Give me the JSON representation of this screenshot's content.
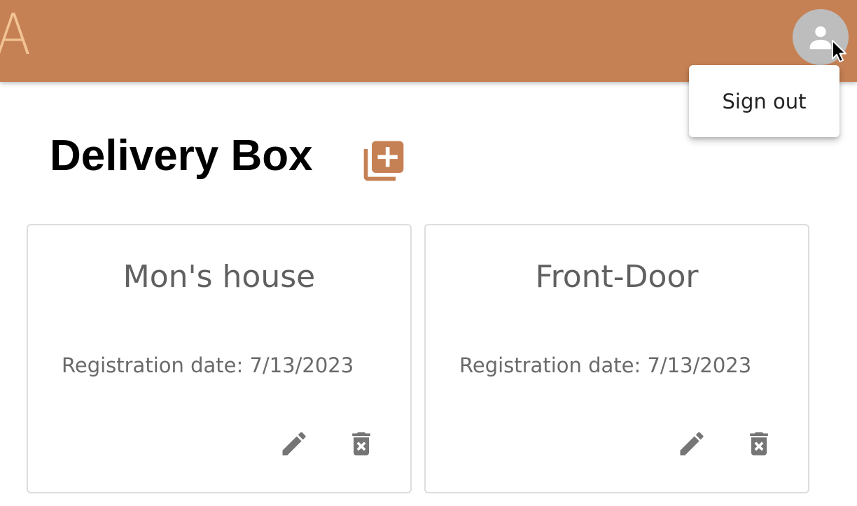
{
  "app": {
    "logo_letter": "A",
    "brand_color": "#c58154",
    "logo_color": "#f2c394"
  },
  "header": {
    "avatar_icon": "person-icon",
    "avatar_bg": "#bdbdbd"
  },
  "account_menu": {
    "items": [
      {
        "label": "Sign out"
      }
    ]
  },
  "page": {
    "title": "Delivery Box",
    "add_icon": "add-box-icon",
    "accent_color": "#c58154"
  },
  "boxes": [
    {
      "name": "Mon's house",
      "date_label": "Registration date:",
      "date_value": "7/13/2023",
      "edit_icon": "edit-icon",
      "delete_icon": "delete-forever-icon"
    },
    {
      "name": "Front-Door",
      "date_label": "Registration date:",
      "date_value": "7/13/2023",
      "edit_icon": "edit-icon",
      "delete_icon": "delete-forever-icon"
    }
  ]
}
